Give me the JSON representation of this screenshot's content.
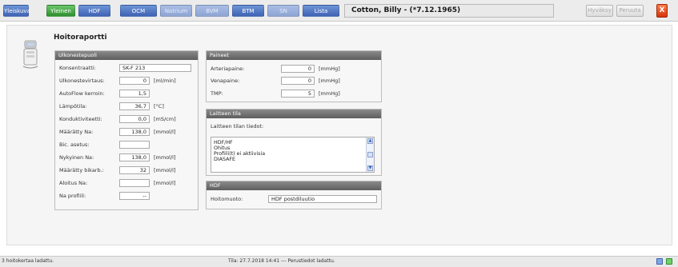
{
  "toolbar": {
    "tabs": [
      {
        "label": "Yleiskuva"
      },
      {
        "label": "Yleinen"
      },
      {
        "label": "HDF"
      },
      {
        "label": "OCM"
      },
      {
        "label": "Natrium"
      },
      {
        "label": "BVM"
      },
      {
        "label": "BTM"
      },
      {
        "label": "SN"
      },
      {
        "label": "Lista"
      }
    ],
    "patient_name": "Cotton, Billy - (*7.12.1965)",
    "confirm_label": "Hyväksy",
    "cancel_label": "Peruuta",
    "close_label": "X"
  },
  "page": {
    "title": "Hoitoraportti"
  },
  "dialysate_panel": {
    "header": "Ulkonestepuoli",
    "rows": [
      {
        "label": "Konsentraatti:",
        "value": "SK-F 213",
        "unit": ""
      },
      {
        "label": "Ulkonestevirtaus:",
        "value": "0",
        "unit": "[ml/min]"
      },
      {
        "label": "AutoFlow kerroin:",
        "value": "1,5",
        "unit": ""
      },
      {
        "label": "Lämpötila:",
        "value": "36,7",
        "unit": "[°C]"
      },
      {
        "label": "Konduktiviteetti:",
        "value": "0,0",
        "unit": "[mS/cm]"
      },
      {
        "label": "Määrätty Na:",
        "value": "138,0",
        "unit": "[mmol/l]"
      },
      {
        "label": "Bic. asetus:",
        "value": "",
        "unit": ""
      },
      {
        "label": "Nykyinen Na:",
        "value": "138,0",
        "unit": "[mmol/l]"
      },
      {
        "label": "Määrätty bikarb.:",
        "value": "32",
        "unit": "[mmol/l]"
      },
      {
        "label": "Aloitus Na:",
        "value": "",
        "unit": "[mmol/l]"
      },
      {
        "label": "Na profiili:",
        "value": "--",
        "unit": ""
      }
    ]
  },
  "pressure_panel": {
    "header": "Paineet",
    "rows": [
      {
        "label": "Arteriapaine:",
        "value": "0",
        "unit": "[mmHg]"
      },
      {
        "label": "Venapaine:",
        "value": "0",
        "unit": "[mmHg]"
      },
      {
        "label": "TMP:",
        "value": "5",
        "unit": "[mmHg]"
      }
    ]
  },
  "device_state_panel": {
    "header": "Laitteen tila",
    "info_label": "Laitteen tilan tiedot:",
    "lines": [
      "HDF/HF",
      "Ohitus",
      "Profiili(t) ei aktiivisia",
      "DIASAFE"
    ]
  },
  "hdf_panel": {
    "header": "HDF",
    "mode_label": "Hoitomuoto:",
    "mode_value": "HDF postdiluutio"
  },
  "status_bar": {
    "left_text": "3 hoitokertaa ladattu.",
    "time_text": "Tila:  27.7.2018 14:41 --- Perustiedot ladattu."
  },
  "colors": {
    "tab_blue": "#3f63b4",
    "tab_green": "#2f8f30",
    "close_red": "#d6340c",
    "panel_header": "#6e6e6e"
  }
}
